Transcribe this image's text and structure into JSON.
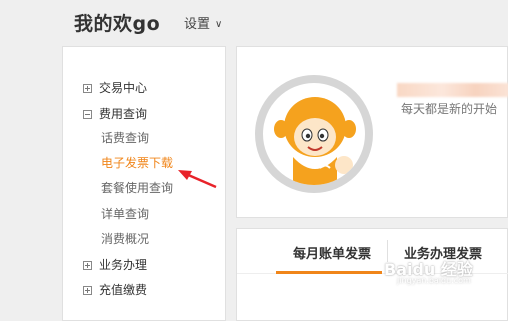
{
  "header": {
    "title": "我的欢go",
    "settings_label": "设置"
  },
  "sidebar": {
    "groups": [
      {
        "label": "交易中心",
        "expanded": false
      },
      {
        "label": "费用查询",
        "expanded": true
      },
      {
        "label": "业务办理",
        "expanded": false
      },
      {
        "label": "充值缴费",
        "expanded": false
      }
    ],
    "sub_items": [
      "话费查询",
      "电子发票下载",
      "套餐使用查询",
      "详单查询",
      "消费概况"
    ],
    "active_item": "电子发票下载"
  },
  "profile": {
    "tagline": "每天都是新的开始"
  },
  "tabs": [
    {
      "label": "每月账单发票",
      "active": true
    },
    {
      "label": "业务办理发票",
      "active": false
    }
  ],
  "watermark": {
    "text": "Baidu 经验",
    "sub": "jingyan.baidu.com"
  },
  "colors": {
    "accent": "#f08519",
    "arrow": "#e8232a"
  }
}
